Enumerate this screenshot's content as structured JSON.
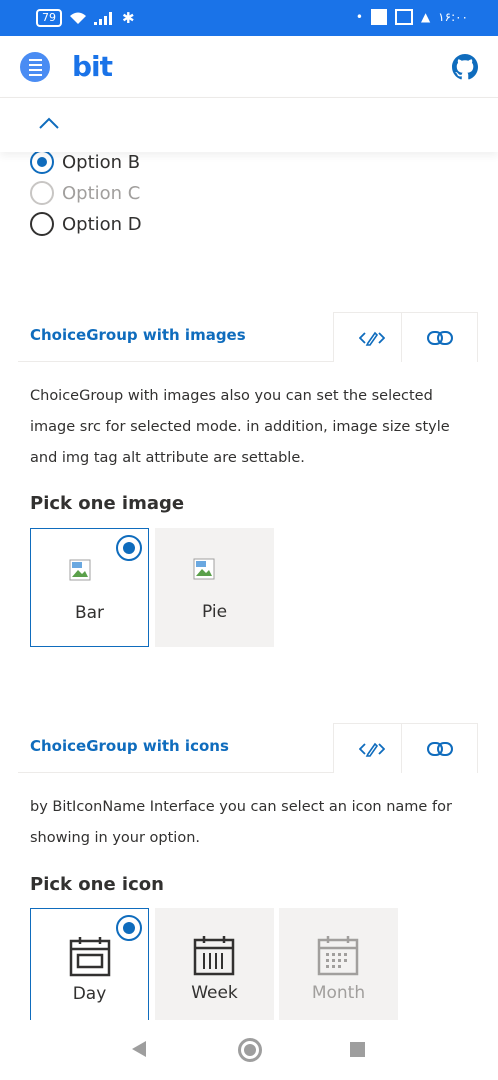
{
  "status_bar": {
    "battery": "79",
    "time": "۱۶:۰۰"
  },
  "app": {
    "logo": "bit"
  },
  "radio_options": [
    {
      "label": "Option B",
      "state": "checked"
    },
    {
      "label": "Option C",
      "state": "disabled"
    },
    {
      "label": "Option D",
      "state": "unchecked"
    }
  ],
  "images_section": {
    "title": "ChoiceGroup with images",
    "description": "ChoiceGroup with images also you can set the selected image src for selected mode. in addition, image size style and img tag alt attribute are settable.",
    "pick_label": "Pick one image",
    "options": [
      {
        "label": "Bar",
        "selected": true
      },
      {
        "label": "Pie",
        "selected": false
      }
    ]
  },
  "icons_section": {
    "title": "ChoiceGroup with icons",
    "description": "by BitIconName Interface you can select an icon name for showing in your option.",
    "pick_label": "Pick one icon",
    "options": [
      {
        "label": "Day",
        "selected": true,
        "disabled": false,
        "icon": "calendar-day-icon"
      },
      {
        "label": "Week",
        "selected": false,
        "disabled": false,
        "icon": "calendar-week-icon"
      },
      {
        "label": "Month",
        "selected": false,
        "disabled": true,
        "icon": "calendar-month-icon"
      }
    ]
  },
  "colors": {
    "accent": "#0f6cbd",
    "statusbar": "#1a73e8"
  }
}
